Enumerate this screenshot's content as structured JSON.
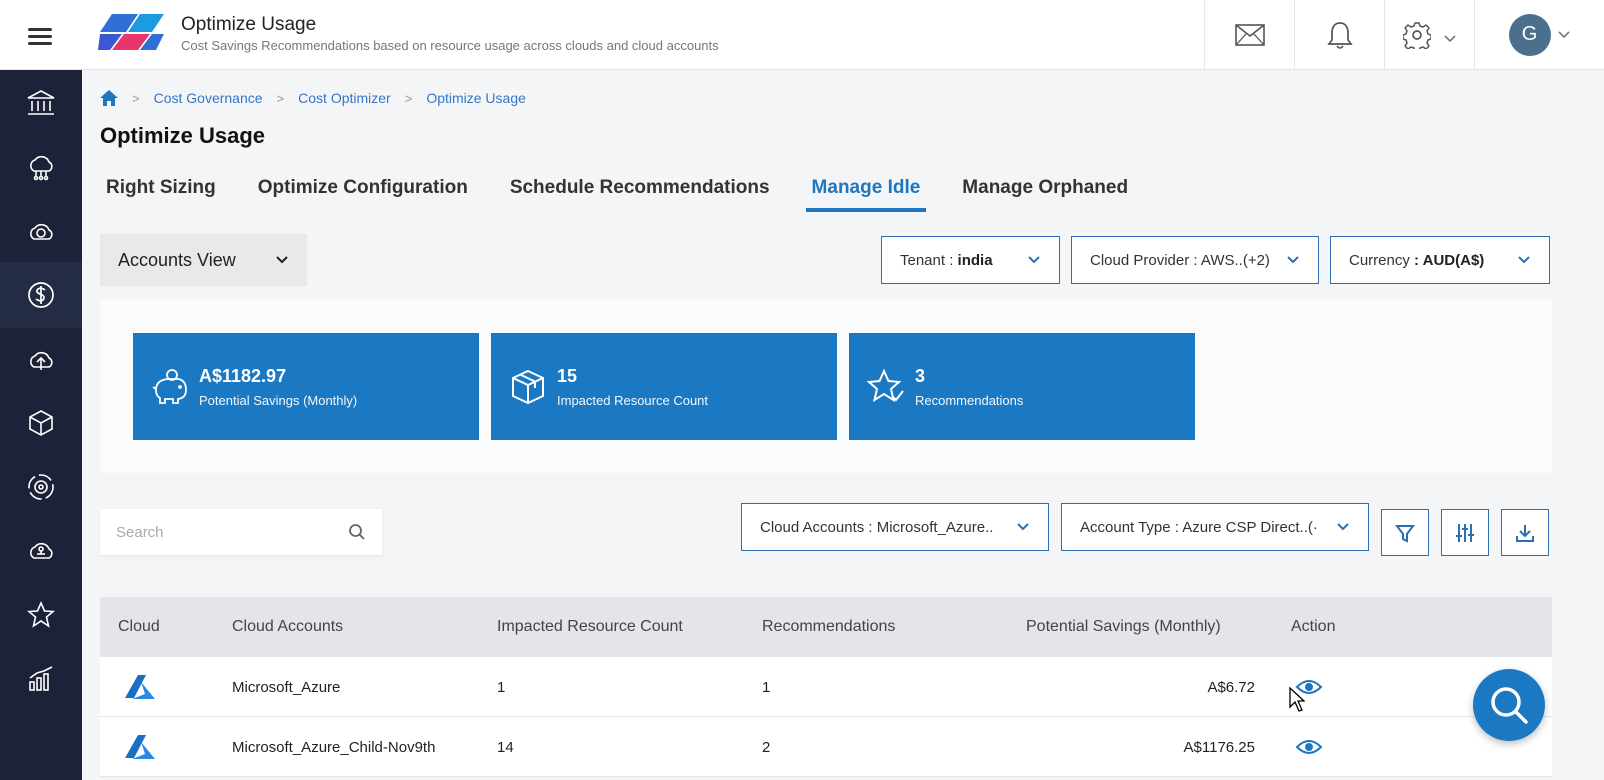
{
  "header": {
    "title": "Optimize Usage",
    "subtitle": "Cost Savings Recommendations based on resource usage across clouds and cloud accounts",
    "avatar_initial": "G"
  },
  "sidebar": {
    "items": [
      {
        "icon": "bank-icon"
      },
      {
        "icon": "cloud-network-icon"
      },
      {
        "icon": "cloud-sync-icon"
      },
      {
        "icon": "dollar-icon",
        "active": true
      },
      {
        "icon": "cloud-upload-icon"
      },
      {
        "icon": "cube-icon"
      },
      {
        "icon": "gear-cycle-icon"
      },
      {
        "icon": "cloud-hierarchy-icon"
      },
      {
        "icon": "star-icon"
      },
      {
        "icon": "bar-chart-icon"
      }
    ]
  },
  "breadcrumb": {
    "items": [
      "Cost Governance",
      "Cost Optimizer",
      "Optimize Usage"
    ],
    "separator": ">"
  },
  "page": {
    "title": "Optimize Usage",
    "tabs": [
      {
        "label": "Right Sizing"
      },
      {
        "label": "Optimize Configuration"
      },
      {
        "label": "Schedule Recommendations"
      },
      {
        "label": "Manage Idle",
        "active": true
      },
      {
        "label": "Manage Orphaned"
      }
    ]
  },
  "filters": {
    "view": "Accounts View",
    "tenant_label": "Tenant : ",
    "tenant_value": "india",
    "provider_label": "Cloud Provider : AWS..(+2)",
    "currency_label": "Currency ",
    "currency_value": ": AUD(A$)"
  },
  "cards": [
    {
      "value": "A$1182.97",
      "label": "Potential Savings (Monthly)",
      "icon": "piggy-bank-icon"
    },
    {
      "value": "15",
      "label": "Impacted Resource Count",
      "icon": "box-icon"
    },
    {
      "value": "3",
      "label": "Recommendations",
      "icon": "star-check-icon"
    }
  ],
  "toolbar": {
    "search_placeholder": "Search",
    "cloud_accounts": "Cloud Accounts : Microsoft_Azure..",
    "account_type": "Account Type : Azure CSP Direct..(·"
  },
  "table": {
    "columns": [
      "Cloud",
      "Cloud Accounts",
      "Impacted Resource Count",
      "Recommendations",
      "Potential Savings (Monthly)",
      "Action"
    ],
    "rows": [
      {
        "cloud": "azure-icon",
        "account": "Microsoft_Azure",
        "count": "1",
        "recs": "1",
        "savings": "A$6.72"
      },
      {
        "cloud": "azure-icon",
        "account": "Microsoft_Azure_Child-Nov9th",
        "count": "14",
        "recs": "2",
        "savings": "A$1176.25"
      }
    ]
  },
  "colors": {
    "accent": "#1b79c4",
    "sidebar": "#1c2237",
    "border": "#2b6fb5"
  }
}
